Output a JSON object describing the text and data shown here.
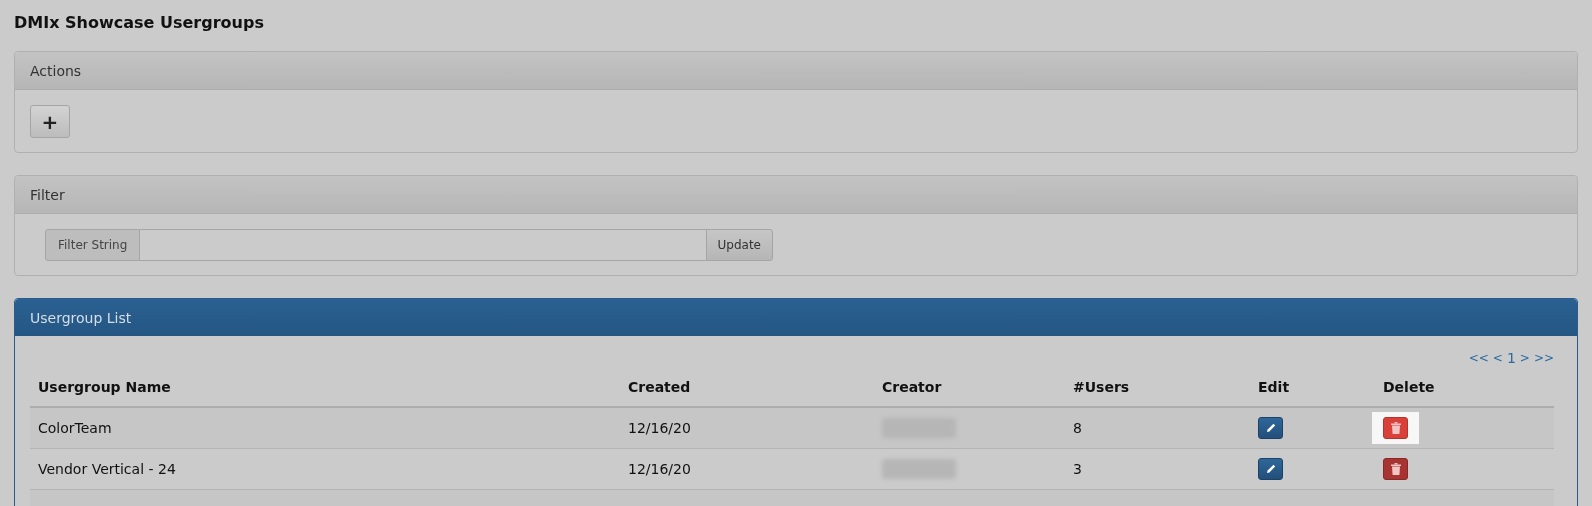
{
  "page_title": "DMIx Showcase Usergroups",
  "actions": {
    "title": "Actions",
    "add_button": "+"
  },
  "filter": {
    "title": "Filter",
    "label": "Filter String",
    "button": "Update"
  },
  "list": {
    "title": "Usergroup List",
    "pagination": [
      "<<",
      "<",
      "1",
      ">",
      ">>"
    ],
    "columns": [
      "Usergroup Name",
      "Created",
      "Creator",
      "#Users",
      "Edit",
      "Delete"
    ],
    "rows": [
      {
        "name": "ColorTeam",
        "created": "12/16/20",
        "users": "8",
        "delete_hovered": true
      },
      {
        "name": "Vendor Vertical - 24",
        "created": "12/16/20",
        "users": "3",
        "delete_hovered": false
      }
    ]
  }
}
